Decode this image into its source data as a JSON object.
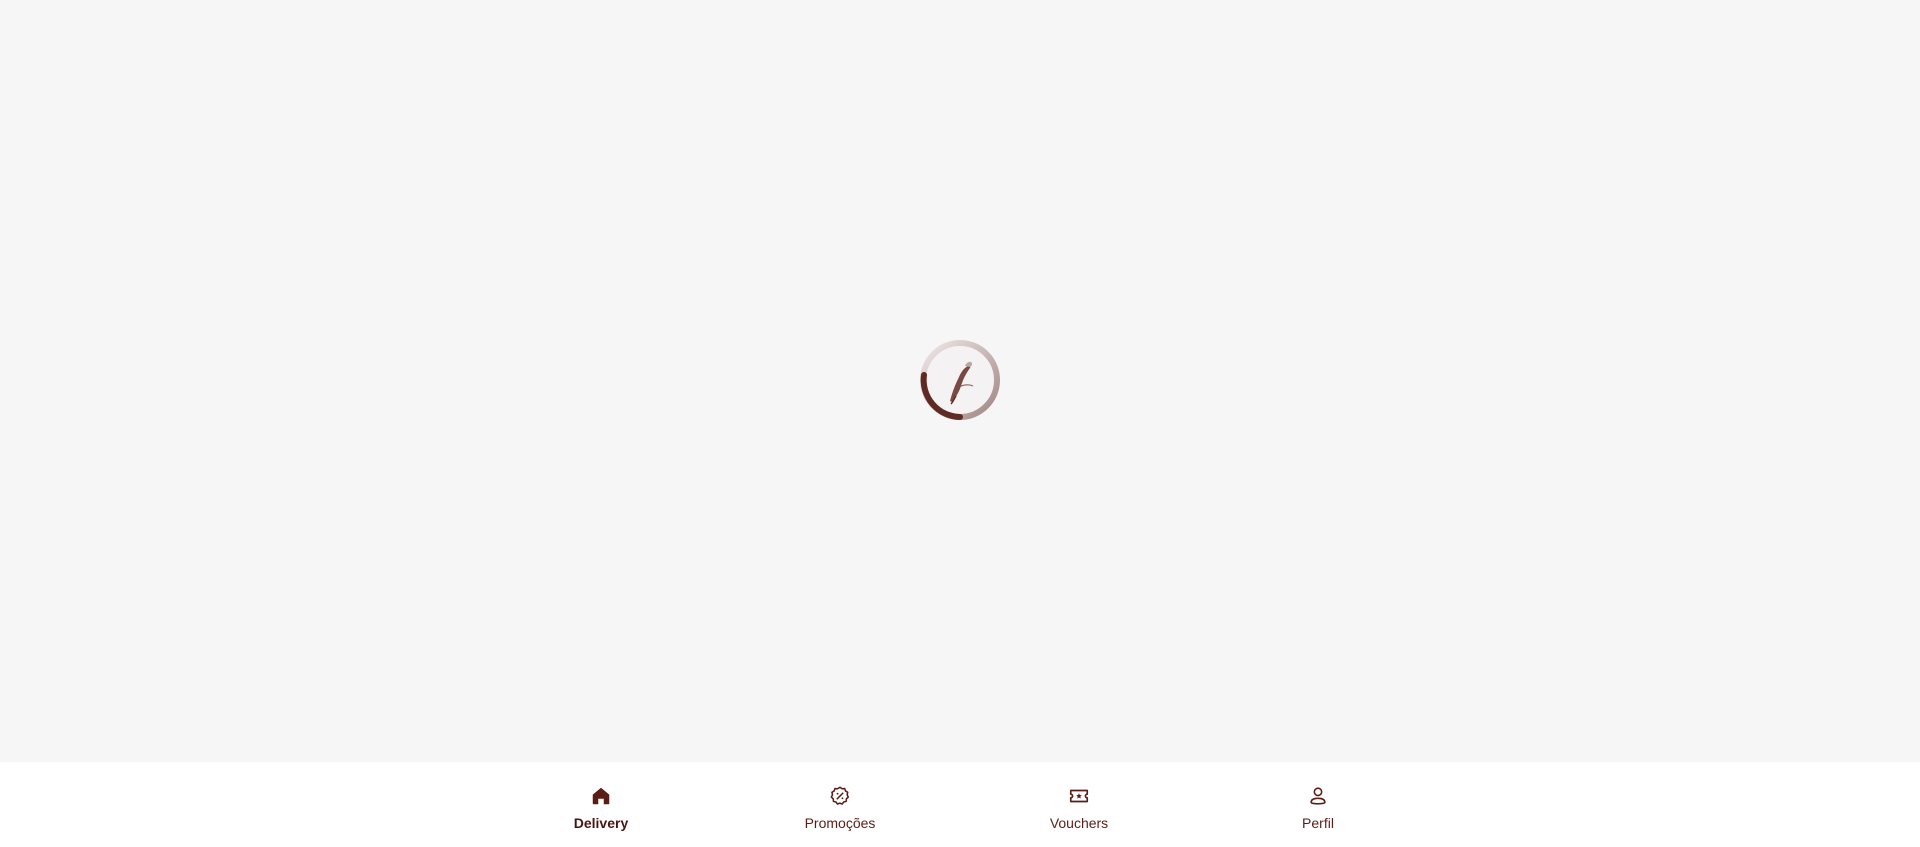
{
  "colors": {
    "background": "#f6f6f6",
    "nav_background": "#ffffff",
    "brand_dark": "#5a1e16",
    "spinner_track": "#c9bcb9",
    "spinner_arc": "#6e3a31"
  },
  "loader": {
    "icon": "bird-logo-icon",
    "state": "loading"
  },
  "bottom_nav": {
    "items": [
      {
        "label": "Delivery",
        "icon": "home-icon",
        "active": true
      },
      {
        "label": "Promoções",
        "icon": "discount-badge-icon",
        "active": false
      },
      {
        "label": "Vouchers",
        "icon": "ticket-icon",
        "active": false
      },
      {
        "label": "Perfil",
        "icon": "user-icon",
        "active": false
      }
    ]
  }
}
